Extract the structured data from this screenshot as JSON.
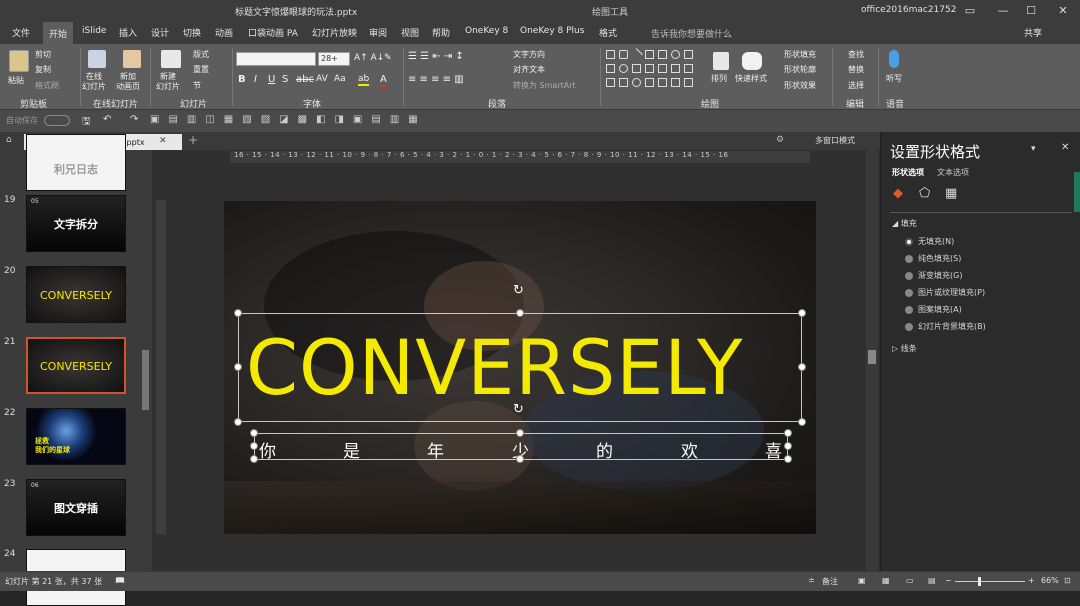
{
  "titlebar": {
    "doc_title": "标题文字惊爆眼球的玩法.pptx",
    "context_tab": "绘图工具",
    "user": "office2016mac21752"
  },
  "tabs": [
    "文件",
    "开始",
    "iSlide",
    "插入",
    "设计",
    "切换",
    "动画",
    "口袋动画 PA",
    "幻灯片放映",
    "审阅",
    "视图",
    "帮助",
    "OneKey 8",
    "OneKey 8 Plus",
    "格式"
  ],
  "active_tab": "开始",
  "tell_me": "告诉我你想要做什么",
  "share": "共享",
  "ribbon": {
    "groups": [
      "剪贴板",
      "在线幻灯片",
      "幻灯片",
      "字体",
      "段落",
      "绘图",
      "编辑",
      "语音"
    ],
    "paste": "粘贴",
    "cut": "剪切",
    "copy": "复制",
    "format_painter": "格式刷",
    "online_slide": "在线\n幻灯片",
    "new_anim_page": "新加\n动画页",
    "new_slide": "新建\n幻灯片",
    "layout": "版式",
    "reset": "重置",
    "section": "节",
    "font_name": "",
    "font_size": "28+",
    "text_direction": "文字方向",
    "align_text": "对齐文本",
    "to_smartart": "转换为 SmartArt",
    "arrange": "排列",
    "quick_styles": "快速样式",
    "shape_fill": "形状填充",
    "shape_outline": "形状轮廓",
    "shape_effect": "形状效果",
    "find": "查找",
    "replace": "替换",
    "select": "选择",
    "dictate": "听写"
  },
  "qat": {
    "autosave": "自动保存"
  },
  "doc_tab": "标题文字惊爆眼球的玩法.pptx",
  "multi_window": "多窗口模式",
  "thumbnails": [
    {
      "num": "",
      "text": "利兄日志"
    },
    {
      "num": "19",
      "text": "文字拆分",
      "badge": "05"
    },
    {
      "num": "20",
      "text": "CONVERSELY"
    },
    {
      "num": "21",
      "text": "CONVERSELY"
    },
    {
      "num": "22",
      "text": "拯救\n我们的星球"
    },
    {
      "num": "23",
      "text": "图文穿插",
      "badge": "06"
    },
    {
      "num": "24",
      "text": ""
    }
  ],
  "ruler_h": "16 · 15 · 14 · 13 · 12 · 11 · 10 · 9 · 8 · 7 · 6 · 5 · 4 · 3 · 2 · 1 · 0 · 1 · 2 · 3 · 4 · 5 · 6 · 7 · 8 · 9 · 10 · 11 · 12 · 13 · 14 · 15 · 16",
  "slide": {
    "title": "CONVERSELY",
    "subtitle_chars": [
      "你",
      "是",
      "年",
      "少",
      "的",
      "欢",
      "喜"
    ]
  },
  "pane": {
    "title": "设置形状格式",
    "tab_shape": "形状选项",
    "tab_text": "文本选项",
    "fill_header": "填充",
    "fill_options": [
      "无填充(N)",
      "纯色填充(S)",
      "渐变填充(G)",
      "图片或纹理填充(P)",
      "图案填充(A)",
      "幻灯片背景填充(B)"
    ],
    "selected_fill": 0,
    "line_header": "线条"
  },
  "status": {
    "slide_info": "幻灯片 第 21 张，共 37 张",
    "notes": "备注",
    "zoom": "66%"
  },
  "colors": {
    "accent_yellow": "#f4e900",
    "selection_border": "#d2532a"
  }
}
